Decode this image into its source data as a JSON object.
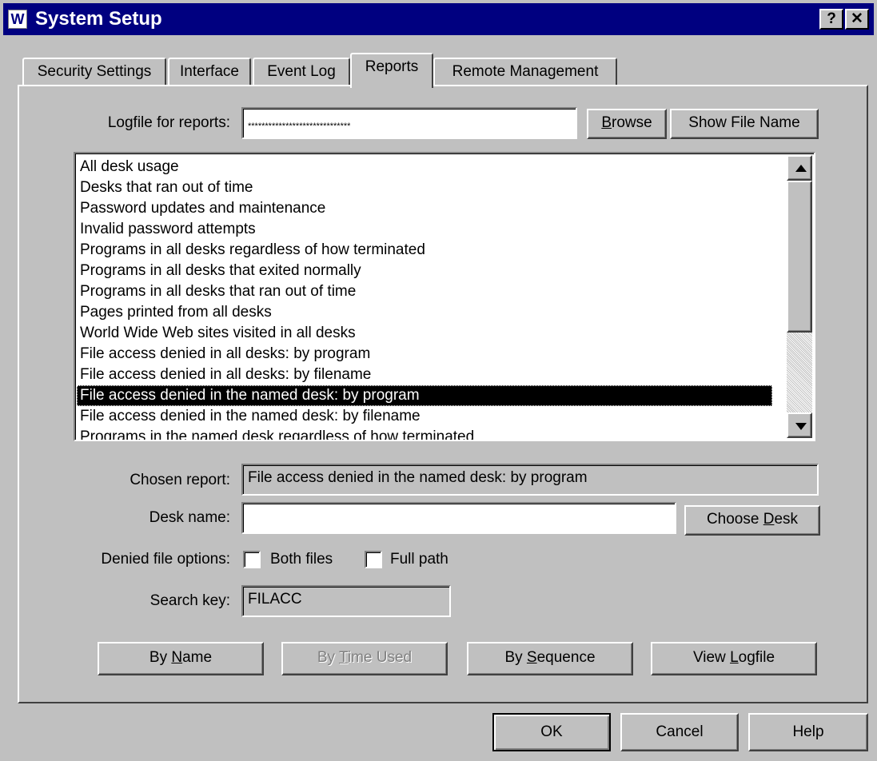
{
  "window": {
    "title": "System Setup",
    "app_icon": "W",
    "help_glyph": "?",
    "close_glyph": "✕"
  },
  "tabs": [
    {
      "label": "Security Settings"
    },
    {
      "label": "Interface"
    },
    {
      "label": "Event Log"
    },
    {
      "label": "Reports",
      "active": true
    },
    {
      "label": "Remote Management"
    }
  ],
  "logfile": {
    "label": "Logfile for reports:",
    "value": "******************************",
    "browse_prefix": "",
    "browse_u": "B",
    "browse_rest": "rowse",
    "show_file_name": "Show File Name"
  },
  "reports": {
    "items": [
      "All desk usage",
      "Desks that ran out of time",
      "Password updates and maintenance",
      "Invalid password attempts",
      "Programs in all desks regardless of how terminated",
      "Programs in all desks that exited normally",
      "Programs in all desks that ran out of time",
      "Pages printed from all desks",
      "World Wide Web sites visited in all desks",
      "File access denied in all desks: by program",
      "File access denied in all desks: by filename",
      "File access denied in the named desk: by program",
      "File access denied in the named desk: by filename",
      "Programs in the named desk regardless of how terminated"
    ],
    "selected_index": 11
  },
  "chosen_report": {
    "label": "Chosen report:",
    "value": "File access denied in the named desk: by program"
  },
  "desk_name": {
    "label": "Desk name:",
    "value": "",
    "button_prefix": "Choose ",
    "button_u": "D",
    "button_rest": "esk"
  },
  "denied_file_options": {
    "label": "Denied file options:",
    "both_files": {
      "label": "Both files",
      "checked": false
    },
    "full_path": {
      "label": "Full path",
      "checked": false
    }
  },
  "search_key": {
    "label": "Search key:",
    "value": "FILACC"
  },
  "actions": {
    "by_name": {
      "prefix": "By ",
      "u": "N",
      "rest": "ame"
    },
    "by_time_used": {
      "prefix": "By ",
      "u": "T",
      "rest": "ime Used",
      "disabled": true
    },
    "by_sequence": {
      "prefix": "By ",
      "u": "S",
      "rest": "equence"
    },
    "view_logfile": {
      "prefix": "View ",
      "u": "L",
      "rest": "ogfile"
    }
  },
  "footer": {
    "ok": "OK",
    "cancel": "Cancel",
    "help": "Help"
  }
}
